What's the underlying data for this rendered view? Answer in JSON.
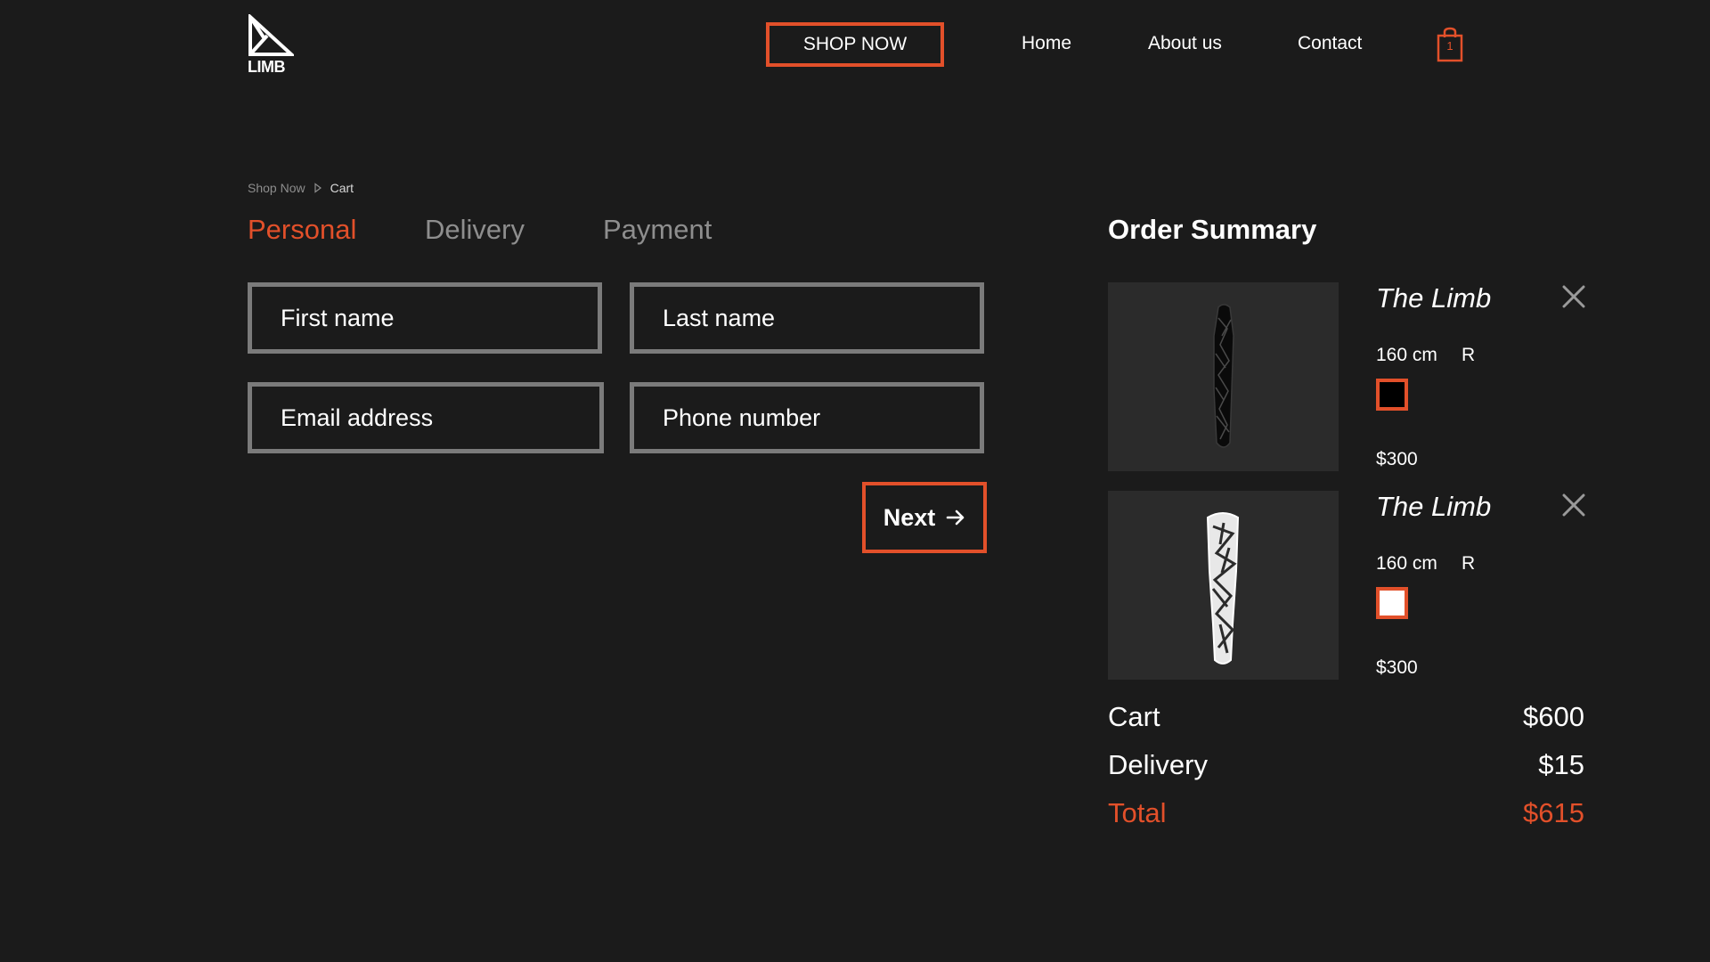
{
  "brand": {
    "logo_text": "LIMB",
    "accent": "#e2502a",
    "background": "#1b1b1b"
  },
  "header": {
    "shop_now": "SHOP NOW",
    "nav": {
      "home": "Home",
      "about": "About us",
      "contact": "Contact"
    },
    "cart_count": "1",
    "cart_icon": "shopping-bag-icon"
  },
  "breadcrumb": {
    "items": [
      "Shop Now",
      "Cart"
    ]
  },
  "steps": {
    "personal": "Personal",
    "delivery": "Delivery",
    "payment": "Payment",
    "active": "Personal"
  },
  "form": {
    "first_name": {
      "placeholder": "First name",
      "value": ""
    },
    "last_name": {
      "placeholder": "Last name",
      "value": ""
    },
    "email": {
      "placeholder": "Email address",
      "value": ""
    },
    "phone": {
      "placeholder": "Phone number",
      "value": ""
    },
    "next": "Next"
  },
  "summary": {
    "title": "Order Summary",
    "items": [
      {
        "name": "The Limb",
        "size": "160 cm",
        "side": "R",
        "color": "#000000",
        "price": "$300"
      },
      {
        "name": "The Limb",
        "size": "160 cm",
        "side": "R",
        "color": "#ffffff",
        "price": "$300"
      }
    ],
    "cart_label": "Cart",
    "cart_value": "$600",
    "delivery_label": "Delivery",
    "delivery_value": "$15",
    "total_label": "Total",
    "total_value": "$615"
  }
}
